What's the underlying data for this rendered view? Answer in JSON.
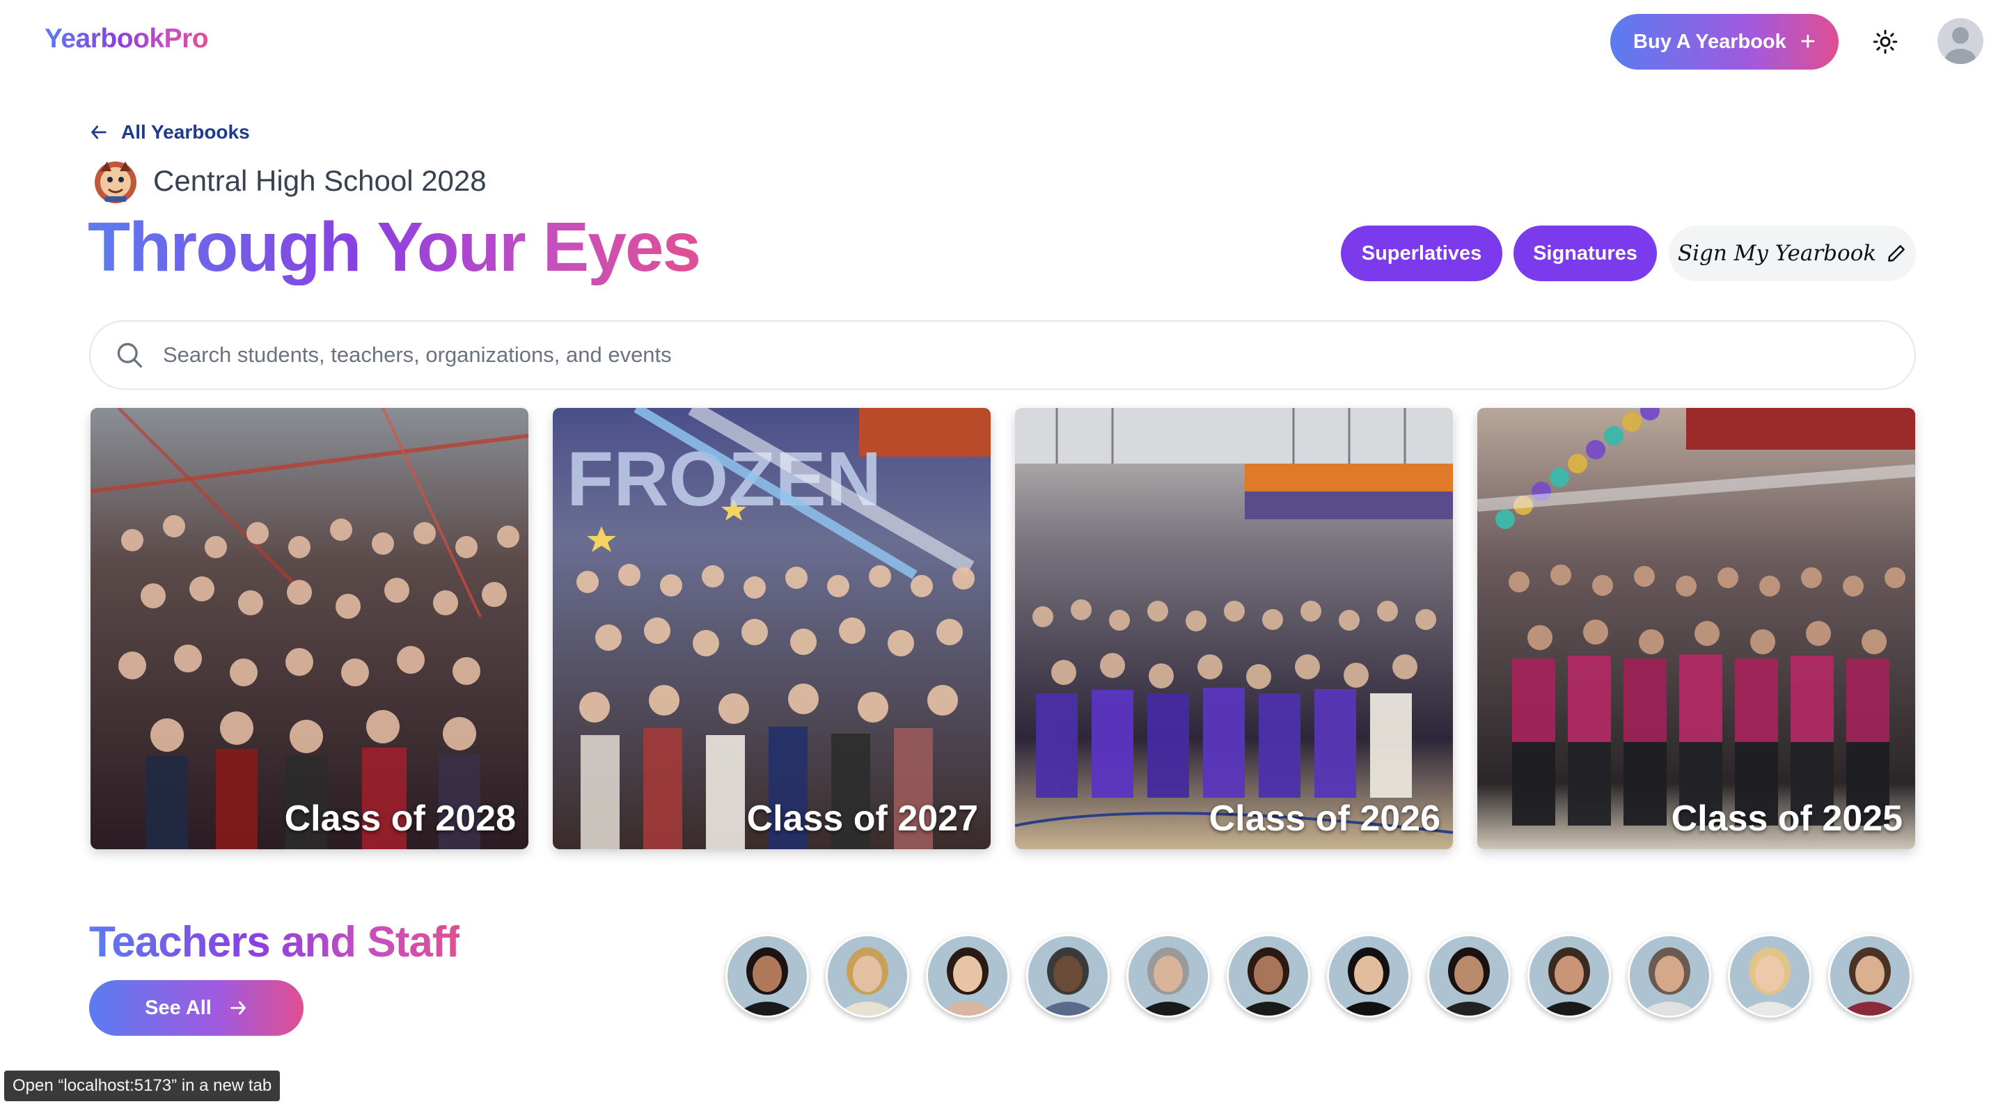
{
  "header": {
    "logo": "YearbookPro",
    "buy_label": "Buy A Yearbook",
    "theme_icon": "sun-icon",
    "profile_icon": "user-avatar-icon"
  },
  "breadcrumb": {
    "back_label": "All Yearbooks"
  },
  "school": {
    "name": "Central High School 2028"
  },
  "hero": {
    "title": "Through Your Eyes"
  },
  "actions": {
    "superlatives": "Superlatives",
    "signatures": "Signatures",
    "sign": "Sign My Yearbook"
  },
  "search": {
    "placeholder": "Search students, teachers, organizations, and events"
  },
  "classes": [
    {
      "label": "Class of 2028"
    },
    {
      "label": "Class of 2027"
    },
    {
      "label": "Class of 2026"
    },
    {
      "label": "Class of 2025"
    }
  ],
  "staff_section": {
    "title": "Teachers and Staff",
    "see_all": "See All",
    "count": 12
  },
  "status_bar": {
    "text": "Open “localhost:5173” in a new tab"
  },
  "colors": {
    "accent_purple": "#7c3aed",
    "gradient_start": "#5b7cf0",
    "gradient_end": "#e04f92",
    "link_blue": "#1e3a8a"
  }
}
